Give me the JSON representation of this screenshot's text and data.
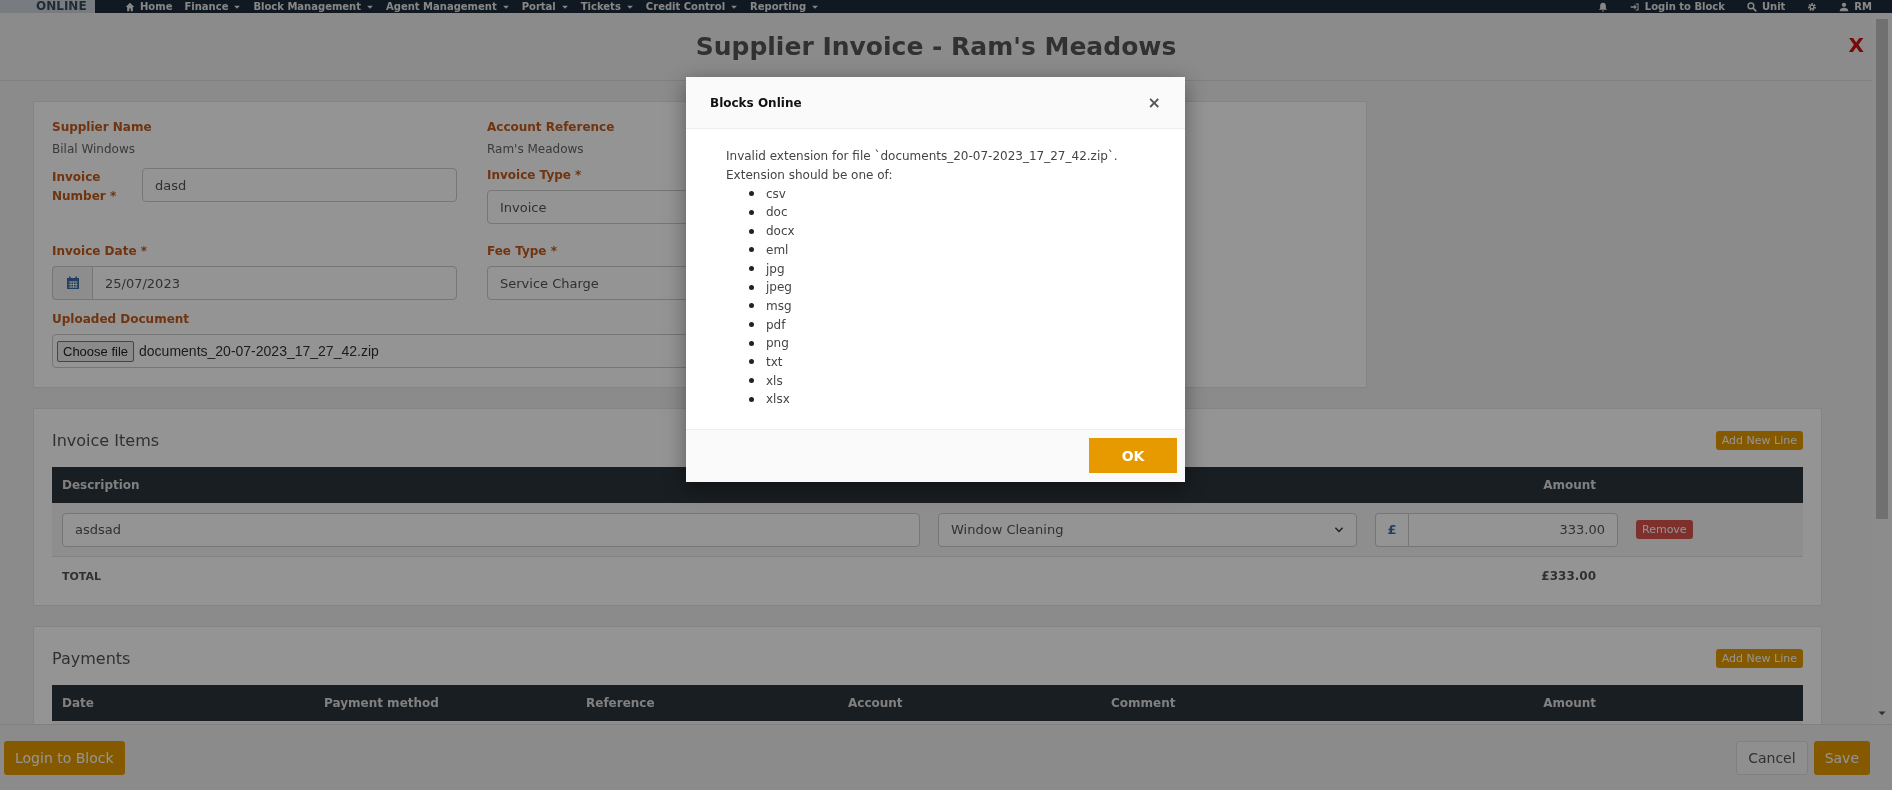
{
  "nav": {
    "logo": "ONLINE",
    "items": [
      {
        "label": "Home",
        "kind": "home",
        "dropdown": false
      },
      {
        "label": "Finance",
        "dropdown": true
      },
      {
        "label": "Block Management",
        "dropdown": true
      },
      {
        "label": "Agent Management",
        "dropdown": true
      },
      {
        "label": "Portal",
        "dropdown": true
      },
      {
        "label": "Tickets",
        "dropdown": true
      },
      {
        "label": "Credit Control",
        "dropdown": true
      },
      {
        "label": "Reporting",
        "dropdown": true
      }
    ],
    "right": [
      {
        "kind": "bell"
      },
      {
        "kind": "signin",
        "label": "Login to Block"
      },
      {
        "kind": "search",
        "label": "Unit"
      },
      {
        "kind": "gear"
      },
      {
        "kind": "user",
        "label": "RM"
      }
    ]
  },
  "page": {
    "title": "Supplier Invoice - Ram's Meadows",
    "close": "X"
  },
  "invoice_form": {
    "fields": [
      {
        "kind": "static",
        "label": "Supplier Name",
        "value": "Bilal Windows"
      },
      {
        "kind": "static",
        "label": "Account Reference",
        "value": "Ram's Meadows"
      },
      {
        "kind": "inline",
        "label": "Invoice Number *",
        "value": "dasd"
      },
      {
        "kind": "select",
        "label": "Invoice Type *",
        "value": "Invoice"
      },
      {
        "kind": "date",
        "label": "Invoice Date *",
        "value": "25/07/2023"
      },
      {
        "kind": "select",
        "label": "Fee Type *",
        "value": "Service Charge"
      },
      {
        "kind": "file",
        "label": "Uploaded Document",
        "button": "Choose file",
        "value": "documents_20-07-2023_17_27_42.zip"
      }
    ]
  },
  "invoice_items": {
    "title": "Invoice Items",
    "add_button": "Add New Line",
    "columns": [
      {
        "kind": "description",
        "label": "Description"
      },
      {
        "kind": "amount",
        "label": "Amount"
      }
    ],
    "rows": [
      {
        "description": "asdsad",
        "service": "Window Cleaning",
        "currency": "£",
        "amount": "333.00",
        "remove": "Remove"
      }
    ],
    "total": {
      "label": "TOTAL",
      "value": "£333.00"
    }
  },
  "payments": {
    "title": "Payments",
    "add_button": "Add New Line",
    "columns": [
      "Date",
      "Payment method",
      "Reference",
      "Account",
      "Comment",
      "Amount"
    ],
    "rows": [
      {
        "kind": "blank"
      }
    ]
  },
  "footer": {
    "left_button": "Login to Block",
    "buttons": [
      {
        "label": "Cancel",
        "kind": "default"
      },
      {
        "label": "Save",
        "kind": "primary"
      }
    ]
  },
  "dialog": {
    "title": "Blocks Online",
    "close": "×",
    "message": "Invalid extension for file `documents_20-07-2023_17_27_42.zip`.",
    "list_intro": "Extension should be one of:",
    "extensions": [
      "csv",
      "doc",
      "docx",
      "eml",
      "jpg",
      "jpeg",
      "msg",
      "pdf",
      "png",
      "txt",
      "xls",
      "xlsx"
    ],
    "ok": "OK"
  }
}
